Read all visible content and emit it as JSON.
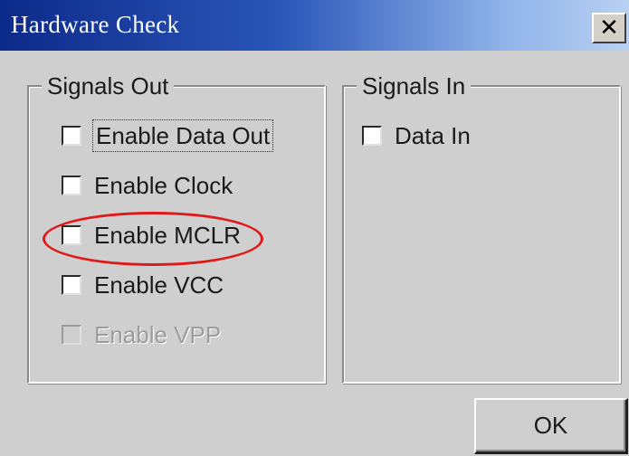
{
  "window": {
    "title": "Hardware Check",
    "close_icon": "close-icon"
  },
  "signals_out": {
    "legend": "Signals Out",
    "items": [
      {
        "label": "Enable Data Out",
        "checked": false,
        "enabled": true,
        "focused": true
      },
      {
        "label": "Enable Clock",
        "checked": false,
        "enabled": true
      },
      {
        "label": "Enable MCLR",
        "checked": false,
        "enabled": true,
        "highlighted": true
      },
      {
        "label": "Enable VCC",
        "checked": false,
        "enabled": true
      },
      {
        "label": "Enable VPP",
        "checked": false,
        "enabled": false
      }
    ]
  },
  "signals_in": {
    "legend": "Signals In",
    "items": [
      {
        "label": "Data In",
        "checked": false,
        "enabled": true
      }
    ]
  },
  "buttons": {
    "ok_label": "OK"
  },
  "colors": {
    "title_bar_start": "#0c2a8a",
    "title_bar_end": "#b9d0f2",
    "highlight": "#e01818",
    "dialog_bg": "#cfcfcf"
  }
}
